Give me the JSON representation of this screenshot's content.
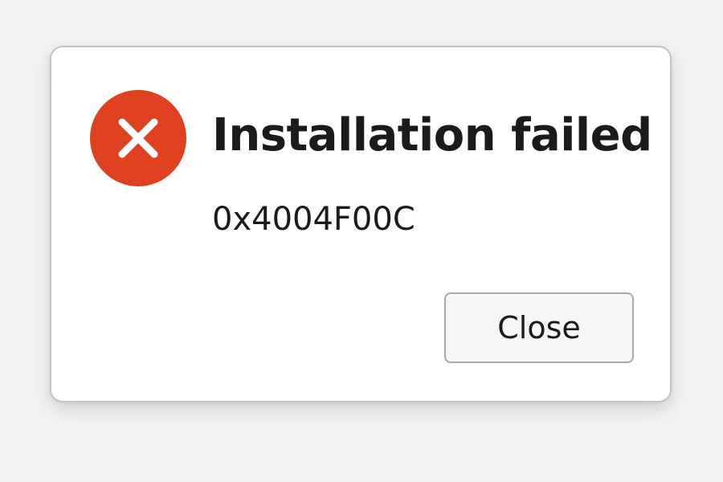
{
  "dialog": {
    "title": "Installation failed",
    "error_code": "0x4004F00C",
    "close_label": "Close",
    "icon": "error-x-icon"
  },
  "colors": {
    "error_red": "#de4020",
    "background": "#f2f2f2",
    "dialog_bg": "#ffffff"
  }
}
